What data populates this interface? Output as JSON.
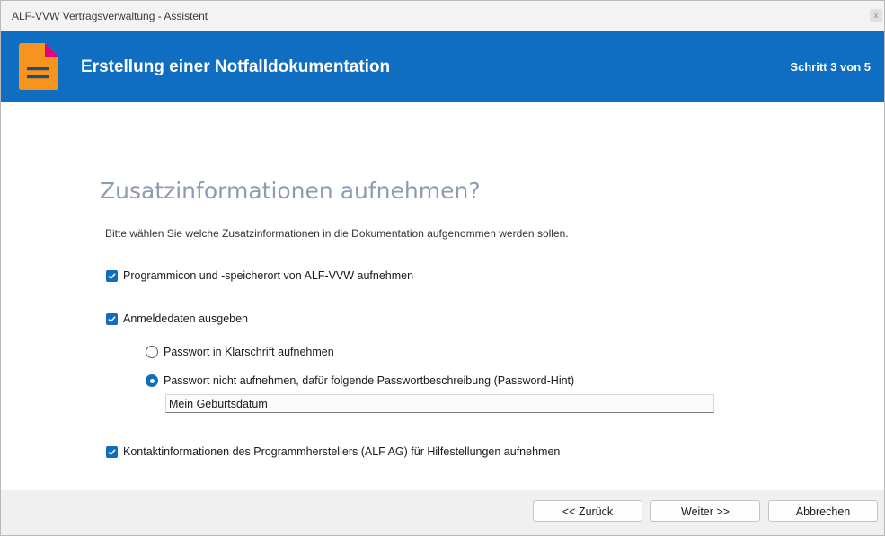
{
  "window": {
    "title": "ALF-VVW Vertragsverwaltung - Assistent",
    "close_glyph": "x"
  },
  "banner": {
    "icon": "document-icon",
    "heading": "Erstellung einer Notfalldokumentation",
    "step": "Schritt 3 von 5",
    "background_color": "#0f6dc2",
    "icon_color": "#f7941d",
    "icon_corner_color": "#e6007e"
  },
  "page": {
    "title": "Zusatzinformationen aufnehmen?",
    "description": "Bitte wählen Sie welche Zusatzinformationen in die Dokumentation aufgenommen werden sollen."
  },
  "options": {
    "program_icon": {
      "label": "Programmicon und -speicherort von ALF-VVW aufnehmen",
      "checked": true
    },
    "login_data": {
      "label": "Anmeldedaten ausgeben",
      "checked": true
    },
    "password_plain": {
      "label": "Passwort in Klarschrift aufnehmen",
      "selected": false
    },
    "password_hint": {
      "label": "Passwort nicht aufnehmen, dafür folgende Passwortbeschreibung (Password-Hint)",
      "selected": true
    },
    "hint_value": "Mein Geburtsdatum",
    "contact_info": {
      "label": "Kontaktinformationen des Programmherstellers (ALF AG) für Hilfestellungen aufnehmen",
      "checked": true
    }
  },
  "footer": {
    "back_label": "<< Zurück",
    "next_label": "Weiter >>",
    "cancel_label": "Abbrechen"
  }
}
